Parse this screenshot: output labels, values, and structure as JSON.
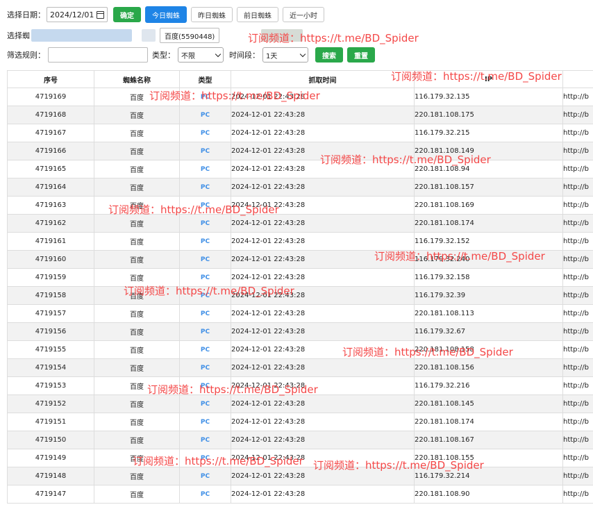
{
  "toolbar": {
    "date_label": "选择日期：",
    "date_value": "2024/12/01",
    "confirm_label": "确定",
    "today_label": "今日蜘蛛",
    "yesterday_label": "昨日蜘蛛",
    "daybefore_label": "前日蜘蛛",
    "lasthour_label": "近一小时",
    "spider_label": "选择蜘",
    "spider_value": "百度(5590448)",
    "filter_label": "筛选规则：",
    "type_label": "类型：",
    "type_value": "不限",
    "period_label": "时间段：",
    "period_value": "1天",
    "search_label": "搜索",
    "reset_label": "重置"
  },
  "table": {
    "headers": [
      "序号",
      "蜘蛛名称",
      "类型",
      "抓取时间",
      "IP",
      ""
    ],
    "rows": [
      [
        "4719169",
        "百度",
        "PC",
        "2024-12-01 22:43:28",
        "116.179.32.135",
        "http://b"
      ],
      [
        "4719168",
        "百度",
        "PC",
        "2024-12-01 22:43:28",
        "220.181.108.175",
        "http://b"
      ],
      [
        "4719167",
        "百度",
        "PC",
        "2024-12-01 22:43:28",
        "116.179.32.215",
        "http://b"
      ],
      [
        "4719166",
        "百度",
        "PC",
        "2024-12-01 22:43:28",
        "220.181.108.149",
        "http://b"
      ],
      [
        "4719165",
        "百度",
        "PC",
        "2024-12-01 22:43:28",
        "220.181.108.94",
        "http://b"
      ],
      [
        "4719164",
        "百度",
        "PC",
        "2024-12-01 22:43:28",
        "220.181.108.157",
        "http://b"
      ],
      [
        "4719163",
        "百度",
        "PC",
        "2024-12-01 22:43:28",
        "220.181.108.169",
        "http://b"
      ],
      [
        "4719162",
        "百度",
        "PC",
        "2024-12-01 22:43:28",
        "220.181.108.174",
        "http://b"
      ],
      [
        "4719161",
        "百度",
        "PC",
        "2024-12-01 22:43:28",
        "116.179.32.152",
        "http://b"
      ],
      [
        "4719160",
        "百度",
        "PC",
        "2024-12-01 22:43:28",
        "116.179.32.240",
        "http://b"
      ],
      [
        "4719159",
        "百度",
        "PC",
        "2024-12-01 22:43:28",
        "116.179.32.158",
        "http://b"
      ],
      [
        "4719158",
        "百度",
        "PC",
        "2024-12-01 22:43:28",
        "116.179.32.39",
        "http://b"
      ],
      [
        "4719157",
        "百度",
        "PC",
        "2024-12-01 22:43:28",
        "220.181.108.113",
        "http://b"
      ],
      [
        "4719156",
        "百度",
        "PC",
        "2024-12-01 22:43:28",
        "116.179.32.67",
        "http://b"
      ],
      [
        "4719155",
        "百度",
        "PC",
        "2024-12-01 22:43:28",
        "220.181.108.158",
        "http://b"
      ],
      [
        "4719154",
        "百度",
        "PC",
        "2024-12-01 22:43:28",
        "220.181.108.156",
        "http://b"
      ],
      [
        "4719153",
        "百度",
        "PC",
        "2024-12-01 22:43:28",
        "116.179.32.216",
        "http://b"
      ],
      [
        "4719152",
        "百度",
        "PC",
        "2024-12-01 22:43:28",
        "220.181.108.145",
        "http://b"
      ],
      [
        "4719151",
        "百度",
        "PC",
        "2024-12-01 22:43:28",
        "220.181.108.174",
        "http://b"
      ],
      [
        "4719150",
        "百度",
        "PC",
        "2024-12-01 22:43:28",
        "220.181.108.167",
        "http://b"
      ],
      [
        "4719149",
        "百度",
        "PC",
        "2024-12-01 22:43:28",
        "220.181.108.155",
        "http://b"
      ],
      [
        "4719148",
        "百度",
        "PC",
        "2024-12-01 22:43:28",
        "116.179.32.214",
        "http://b"
      ],
      [
        "4719147",
        "百度",
        "PC",
        "2024-12-01 22:43:28",
        "220.181.108.90",
        "http://b"
      ]
    ]
  },
  "watermark": "订阅频道：https://t.me/BD_Spider",
  "colors": {
    "green": "#2aa84a",
    "blue": "#1e84e6",
    "watermark": "#f44848",
    "pc_text": "#3f8fe6"
  }
}
